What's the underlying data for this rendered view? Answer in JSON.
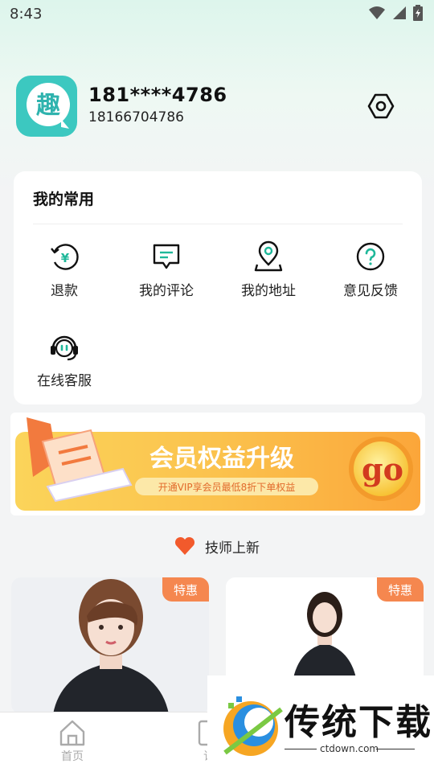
{
  "status_bar": {
    "time": "8:43"
  },
  "profile": {
    "masked_phone": "181****4786",
    "phone": "18166704786",
    "avatar_char": "趣"
  },
  "services": {
    "title": "我的常用",
    "items": [
      {
        "label": "退款",
        "icon": "refund-icon"
      },
      {
        "label": "我的评论",
        "icon": "comment-icon"
      },
      {
        "label": "我的地址",
        "icon": "location-icon"
      },
      {
        "label": "意见反馈",
        "icon": "feedback-icon"
      },
      {
        "label": "在线客服",
        "icon": "customer-service-icon"
      }
    ]
  },
  "banner": {
    "title": "会员权益升级",
    "subtitle": "开通VIP享会员最低8折下单权益",
    "go": "go"
  },
  "section": {
    "title": "技师上新"
  },
  "technicians": [
    {
      "badge": "特惠"
    },
    {
      "badge": "特惠"
    }
  ],
  "bottom_nav": {
    "items": [
      {
        "label": "首页"
      },
      {
        "label": "订"
      }
    ]
  },
  "watermark": {
    "title": "传统下载",
    "url": "ctdown.com"
  },
  "colors": {
    "accent": "#1fb89a",
    "badge": "#f5874f",
    "heart": "#f25a2c",
    "banner": "#fbb53a"
  }
}
